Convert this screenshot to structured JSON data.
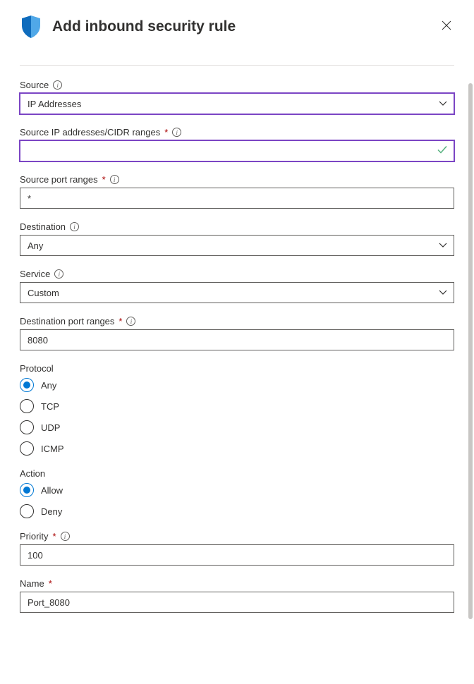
{
  "header": {
    "title": "Add inbound security rule"
  },
  "fields": {
    "source": {
      "label": "Source",
      "value": "IP Addresses"
    },
    "sourceIp": {
      "label": "Source IP addresses/CIDR ranges",
      "value": ""
    },
    "sourcePort": {
      "label": "Source port ranges",
      "value": "*"
    },
    "destination": {
      "label": "Destination",
      "value": "Any"
    },
    "service": {
      "label": "Service",
      "value": "Custom"
    },
    "destPort": {
      "label": "Destination port ranges",
      "value": "8080"
    },
    "protocol": {
      "label": "Protocol",
      "options": [
        "Any",
        "TCP",
        "UDP",
        "ICMP"
      ],
      "selected": "Any"
    },
    "action": {
      "label": "Action",
      "options": [
        "Allow",
        "Deny"
      ],
      "selected": "Allow"
    },
    "priority": {
      "label": "Priority",
      "value": "100"
    },
    "name": {
      "label": "Name",
      "value": "Port_8080"
    }
  }
}
